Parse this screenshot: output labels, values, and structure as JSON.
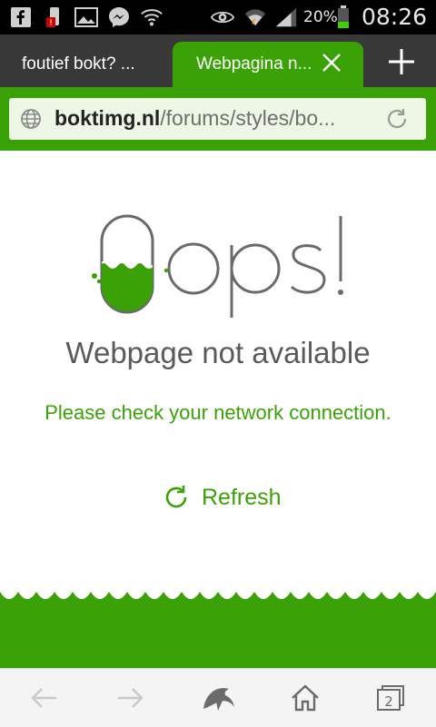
{
  "status_bar": {
    "battery": "20%",
    "time": "08:26",
    "icons": [
      "facebook-icon",
      "battery-alert-icon",
      "gallery-icon",
      "messenger-icon",
      "wifi-hotspot-icon",
      "eye-icon",
      "wifi-icon",
      "signal-icon",
      "battery-icon"
    ]
  },
  "tabs": [
    {
      "label": "foutief bokt? ...",
      "active": false
    },
    {
      "label": "Webpagina n...",
      "active": true
    }
  ],
  "url": {
    "domain": "boktimg.nl",
    "path": "/forums/styles/bo..."
  },
  "error": {
    "logo_text": "Oops!",
    "title": "Webpage not available",
    "message": "Please check your network connection.",
    "refresh_label": "Refresh"
  },
  "bottom_nav": {
    "tab_count": "2",
    "icons": [
      "back-arrow-icon",
      "forward-arrow-icon",
      "dolphin-icon",
      "home-icon",
      "tabs-icon"
    ]
  },
  "colors": {
    "accent": "#3aa207",
    "tab_bar": "#383838",
    "status_bar": "#000000"
  }
}
